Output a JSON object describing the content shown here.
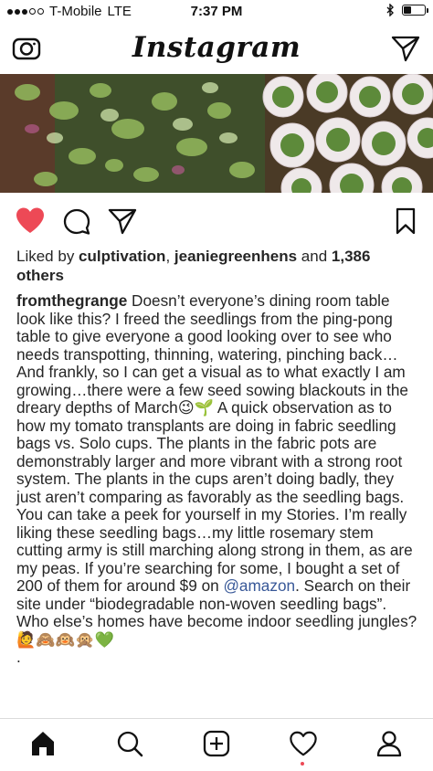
{
  "status_bar": {
    "carrier": "T-Mobile",
    "network": "LTE",
    "time": "7:37 PM"
  },
  "header": {
    "logo_text": "Instagram",
    "camera_icon": "camera-icon",
    "direct_icon": "paper-plane-icon"
  },
  "post": {
    "photo_alt": "seedlings on table",
    "liked": true,
    "like_color": "#ed4956",
    "likes": {
      "prefix": "Liked by ",
      "user1": "culptivation",
      "sep": ", ",
      "user2": "jeaniegreenhens",
      "middle": " and ",
      "count": "1,386 others"
    },
    "caption": {
      "username": "fromthegrange",
      "text_part1": " Doesn’t everyone’s dining room table look like this? I freed the seedlings from the ping-pong table to give everyone a good looking over to see who needs transpotting, thinning, watering, pinching back… And frankly, so I can get a visual as to what exactly I am growing…there were a few seed sowing blackouts in the dreary depths of March😉🌱 A quick observation as to how my tomato transplants are doing in fabric seedling bags vs. Solo cups. The plants in the fabric pots are demonstrably larger and more vibrant with a strong root system. The plants in the cups aren’t doing badly, they just aren’t comparing as favorably as the seedling bags. You can take a peek for yourself in my Stories. I’m really liking these seedling bags…my little rosemary stem cutting army is still marching along strong in them, as are my peas. If you’re searching for some, I bought a set of 200 of them for around $9 on ",
      "mention": "@amazon",
      "text_part2": ". Search on their site under “biodegradable non-woven seedling bags”. Who else’s homes have become indoor seedling jungles?🙋🙈🙉🙊💚",
      "trailing_dot": "."
    }
  },
  "bottom_nav": {
    "items": [
      "home-icon",
      "search-icon",
      "add-post-icon",
      "activity-heart-icon",
      "profile-icon"
    ],
    "active": "home-icon"
  }
}
